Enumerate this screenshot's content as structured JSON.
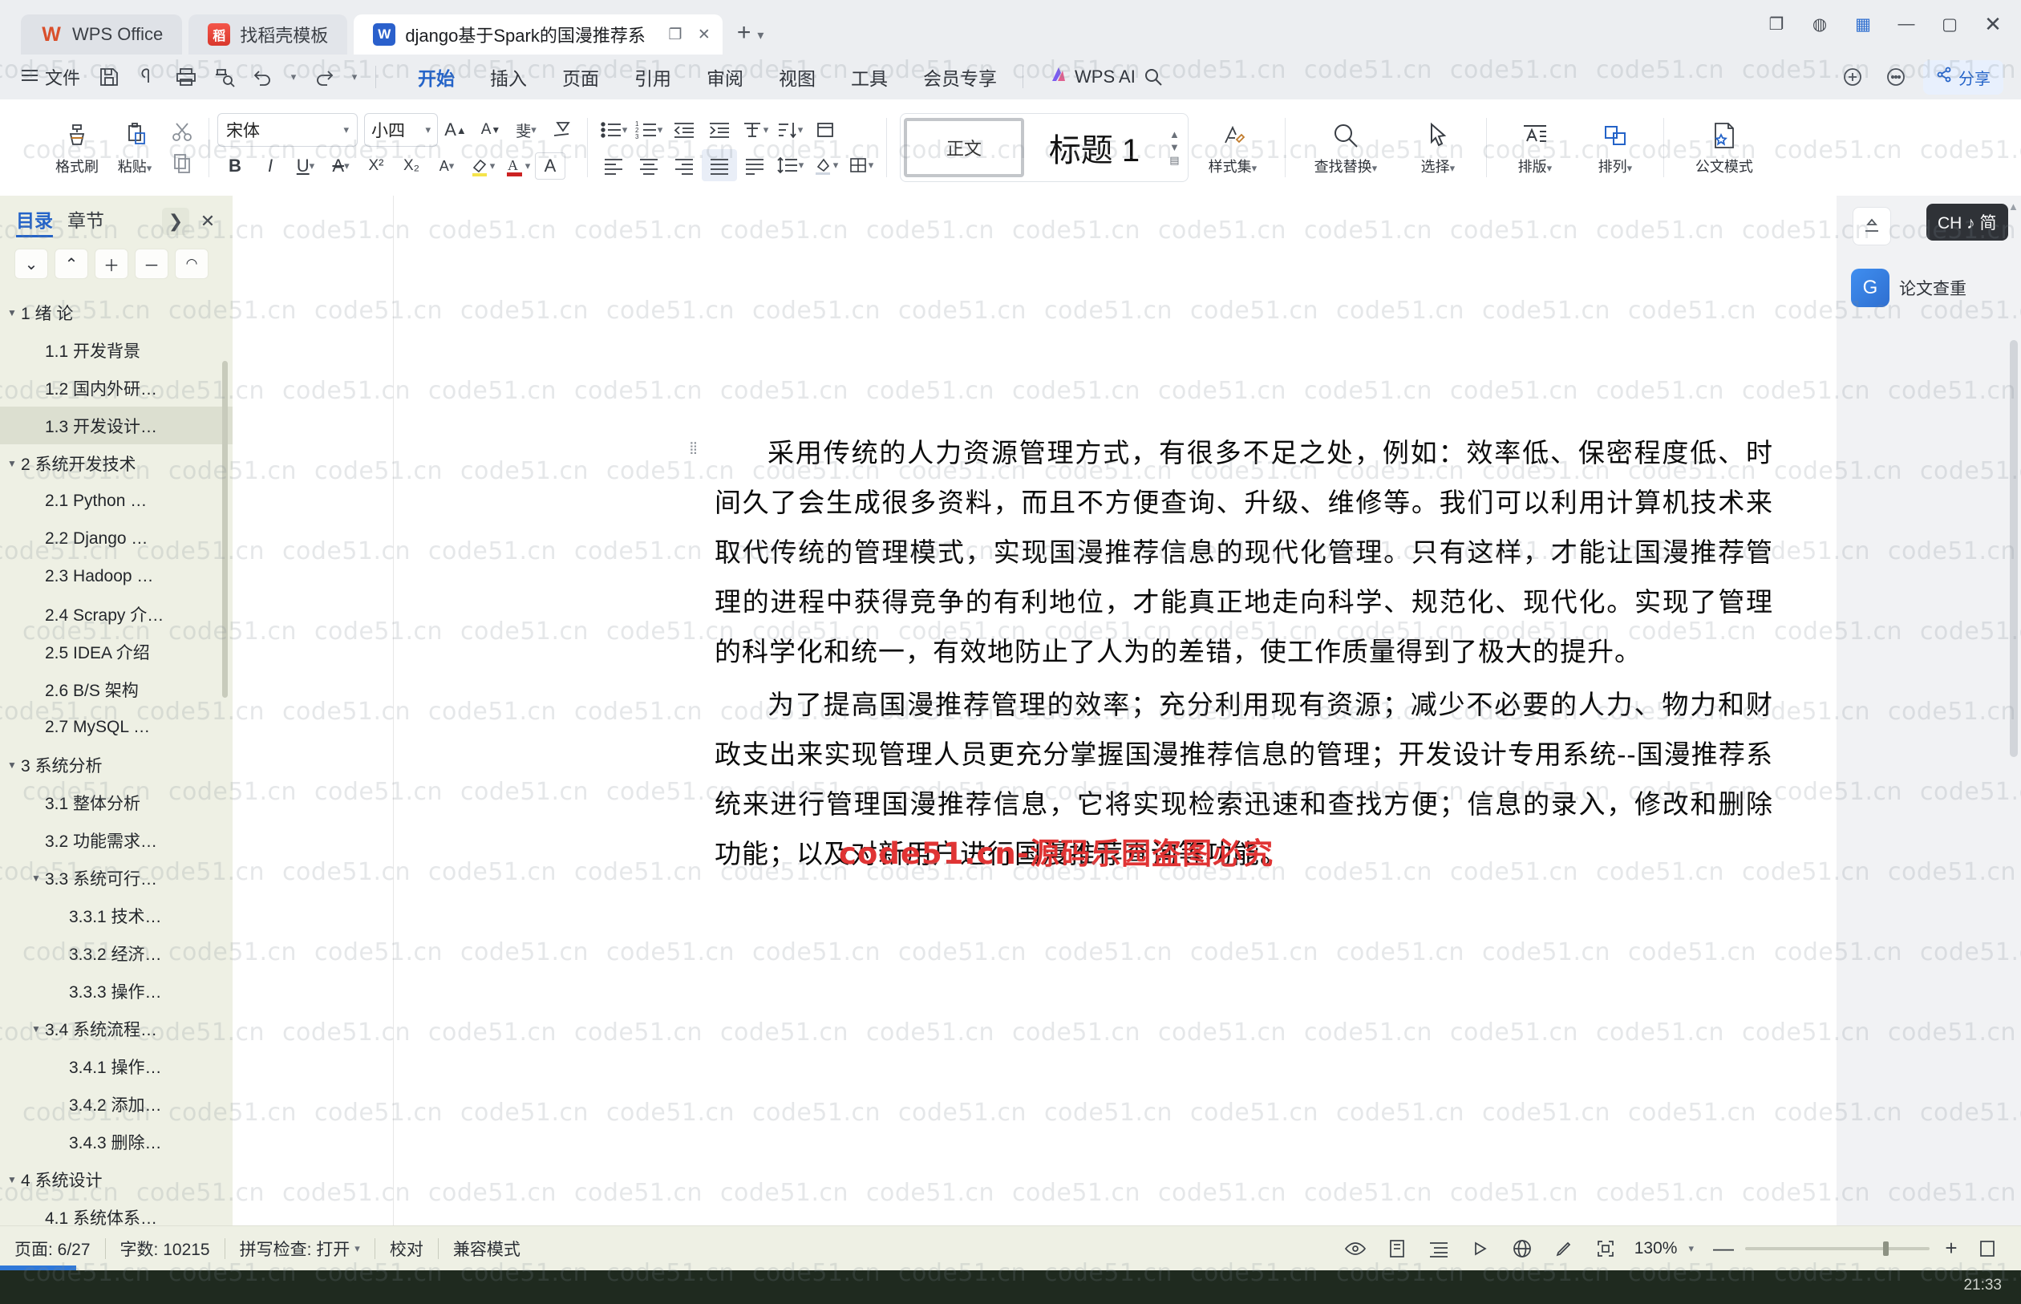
{
  "window": {
    "tabs": [
      {
        "label": "WPS Office",
        "icon": "wps-logo-icon",
        "active": false
      },
      {
        "label": "找稻壳模板",
        "icon": "docer-icon",
        "active": false
      },
      {
        "label": "django基于Spark的国漫推荐系",
        "icon": "word-doc-icon",
        "active": true
      }
    ],
    "new_tab_label": "+",
    "controls": {
      "restore_split": "❐",
      "cloud": "☁",
      "screen": "🖵",
      "minimize": "—",
      "maximize": "▢",
      "close": "✕"
    }
  },
  "menubar": {
    "file_label": "文件",
    "quick_icons": [
      "menu-icon",
      "save-icon",
      "cloud-save-icon",
      "print-icon",
      "print-preview-icon",
      "undo-icon",
      "redo-icon",
      "customize-icon"
    ],
    "ribbon_tabs": [
      {
        "label": "开始",
        "active": true
      },
      {
        "label": "插入",
        "active": false
      },
      {
        "label": "页面",
        "active": false
      },
      {
        "label": "引用",
        "active": false
      },
      {
        "label": "审阅",
        "active": false
      },
      {
        "label": "视图",
        "active": false
      },
      {
        "label": "工具",
        "active": false
      },
      {
        "label": "会员专享",
        "active": false
      }
    ],
    "wps_ai_label": "WPS AI",
    "search_icon": "search-icon",
    "right_icons": [
      "collab-icon",
      "comment-icon"
    ],
    "share_label": "分享"
  },
  "ribbon": {
    "format_painter": "格式刷",
    "paste": "粘贴",
    "cut_icon": "scissors-icon",
    "copy_icon": "copy-icon",
    "font_family": "宋体",
    "font_size": "小四",
    "grow_font_icon": "grow-font-icon",
    "shrink_font_icon": "shrink-font-icon",
    "pinyin_icon": "pinyin-guide-icon",
    "clear_format_icon": "clear-format-icon",
    "bold": "B",
    "italic": "I",
    "underline": "U",
    "strike_icon": "strikethrough-icon",
    "superscript": "X²",
    "subscript": "X₂",
    "char_border_icon": "char-border-icon",
    "highlight_icon": "highlight-icon",
    "font_color_icon": "font-color-icon",
    "char_shading_icon": "char-shading-icon",
    "bullets_icon": "bullet-list-icon",
    "numbering_icon": "numbered-list-icon",
    "outdent_icon": "decrease-indent-icon",
    "indent_icon": "increase-indent-icon",
    "asian_layout_icon": "asian-layout-icon",
    "sort_icon": "sort-icon",
    "line_break_icon": "line-break-icon",
    "show_marks_icon": "show-marks-icon",
    "align_left_icon": "align-left-icon",
    "align_center_icon": "align-center-icon",
    "align_right_icon": "align-right-icon",
    "align_justify_icon": "align-justify-icon",
    "align_distributed_icon": "align-distributed-icon",
    "line_spacing_icon": "line-spacing-icon",
    "shading_icon": "shading-icon",
    "borders_icon": "borders-icon",
    "styles": [
      {
        "label": "正文",
        "selected": true
      },
      {
        "label": "标题 1",
        "selected": false
      }
    ],
    "style_set": "样式集",
    "find_replace": "查找替换",
    "select": "选择",
    "typeset": "排版",
    "arrange": "排列",
    "official_mode": "公文模式"
  },
  "sidebar": {
    "tabs": [
      {
        "label": "目录",
        "active": true
      },
      {
        "label": "章节",
        "active": false
      }
    ],
    "collapse_icon": "chevron-right-icon",
    "close_icon": "close-icon",
    "controls": [
      "expand-down-icon",
      "collapse-up-icon",
      "plus-icon",
      "minus-icon",
      "level-icon"
    ],
    "tree": [
      {
        "label": "1 绪  论",
        "level": 0,
        "arrow": "▼",
        "selected": false
      },
      {
        "label": "1.1 开发背景",
        "level": 1,
        "arrow": "",
        "selected": false
      },
      {
        "label": "1.2 国内外研…",
        "level": 1,
        "arrow": "",
        "selected": false
      },
      {
        "label": "1.3 开发设计…",
        "level": 1,
        "arrow": "",
        "selected": true
      },
      {
        "label": "2 系统开发技术",
        "level": 0,
        "arrow": "▼",
        "selected": false
      },
      {
        "label": "2.1 Python …",
        "level": 1,
        "arrow": "",
        "selected": false
      },
      {
        "label": "2.2 Django …",
        "level": 1,
        "arrow": "",
        "selected": false
      },
      {
        "label": "2.3 Hadoop …",
        "level": 1,
        "arrow": "",
        "selected": false
      },
      {
        "label": "2.4 Scrapy 介…",
        "level": 1,
        "arrow": "",
        "selected": false
      },
      {
        "label": "2.5 IDEA 介绍",
        "level": 1,
        "arrow": "",
        "selected": false
      },
      {
        "label": "2.6 B/S 架构",
        "level": 1,
        "arrow": "",
        "selected": false
      },
      {
        "label": "2.7 MySQL …",
        "level": 1,
        "arrow": "",
        "selected": false
      },
      {
        "label": "3 系统分析",
        "level": 0,
        "arrow": "▼",
        "selected": false
      },
      {
        "label": "3.1 整体分析",
        "level": 1,
        "arrow": "",
        "selected": false
      },
      {
        "label": "3.2 功能需求…",
        "level": 1,
        "arrow": "",
        "selected": false
      },
      {
        "label": "3.3  系统可行…",
        "level": 1,
        "arrow": "▼",
        "selected": false
      },
      {
        "label": "3.3.1 技术…",
        "level": 2,
        "arrow": "",
        "selected": false
      },
      {
        "label": "3.3.2 经济…",
        "level": 2,
        "arrow": "",
        "selected": false
      },
      {
        "label": "3.3.3 操作…",
        "level": 2,
        "arrow": "",
        "selected": false
      },
      {
        "label": "3.4 系统流程…",
        "level": 1,
        "arrow": "▼",
        "selected": false
      },
      {
        "label": "3.4.1 操作…",
        "level": 2,
        "arrow": "",
        "selected": false
      },
      {
        "label": "3.4.2 添加…",
        "level": 2,
        "arrow": "",
        "selected": false
      },
      {
        "label": "3.4.3 删除…",
        "level": 2,
        "arrow": "",
        "selected": false
      },
      {
        "label": "4 系统设计",
        "level": 0,
        "arrow": "▼",
        "selected": false
      },
      {
        "label": "4.1 系统体系…",
        "level": 1,
        "arrow": "",
        "selected": false
      }
    ]
  },
  "document": {
    "paragraphs": [
      "采用传统的人力资源管理方式，有很多不足之处，例如：效率低、保密程度低、时间久了会生成很多资料，而且不方便查询、升级、维修等。我们可以利用计算机技术来取代传统的管理模式，实现国漫推荐信息的现代化管理。只有这样，才能让国漫推荐管理的进程中获得竞争的有利地位，才能真正地走向科学、规范化、现代化。实现了管理的科学化和统一，有效地防止了人为的差错，使工作质量得到了极大的提升。",
      "为了提高国漫推荐管理的效率；充分利用现有资源；减少不必要的人力、物力和财政支出来实现管理人员更充分掌握国漫推荐信息的管理；开发设计专用系统--国漫推荐系统来进行管理国漫推荐信息，它将实现检索迅速和查找方便；信息的录入，修改和删除功能；以及对新用户进行国漫推荐查询等功能。"
    ],
    "stamp": "code51.cn-源码乐园盗图必究"
  },
  "right_rail": {
    "top_button_icon": "collapse-pane-icon",
    "ime_badge": "CH ♪ 简",
    "card_label": "论文查重",
    "card_icon": "plagiarism-check-icon"
  },
  "statusbar": {
    "page": "页面: 6/27",
    "word_count": "字数: 10215",
    "spell_check": "拼写检查: 打开",
    "proofread": "校对",
    "compat_mode": "兼容模式",
    "right_icons": [
      "eye-icon",
      "page-layout-icon",
      "outline-view-icon",
      "read-view-icon",
      "web-view-icon",
      "pen-icon",
      "fullscreen-icon"
    ],
    "zoom": "130%",
    "zoom_out": "—",
    "zoom_in": "+"
  },
  "taskbar": {
    "time": "21:33"
  },
  "watermark": {
    "text": "code51.cn"
  },
  "colors": {
    "accent": "#2463c8",
    "stamp": "#e03434",
    "sidebar_bg": "#eef0e4",
    "ribbon_bg": "#ffffff"
  }
}
